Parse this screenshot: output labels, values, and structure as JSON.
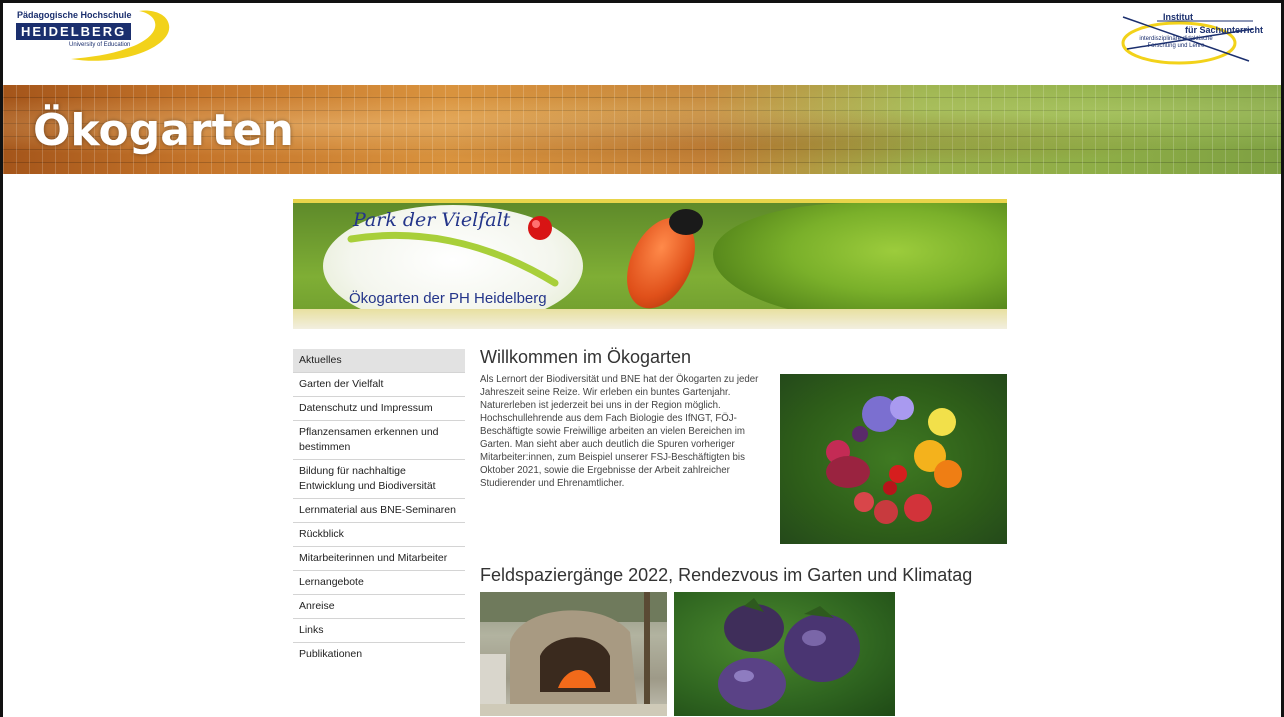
{
  "logos": {
    "ph": {
      "line1": "Pädagogische Hochschule",
      "line2": "HEIDELBERG",
      "line3": "University of Education"
    },
    "institute": {
      "line1": "Institut",
      "line2": "für Sachunterricht",
      "line3": "interdisziplinäre didaktische Forschung und Lehre"
    }
  },
  "banner": {
    "title": "Ökogarten"
  },
  "site_header": {
    "title": "Park der Vielfalt",
    "subtitle": "Ökogarten der PH Heidelberg"
  },
  "nav": {
    "items": [
      {
        "label": "Aktuelles",
        "active": true
      },
      {
        "label": "Garten der Vielfalt"
      },
      {
        "label": "Datenschutz und Impressum"
      },
      {
        "label": "Pflanzensamen erkennen und bestimmen"
      },
      {
        "label": "Bildung für nachhaltige Entwicklung und Biodiversität"
      },
      {
        "label": "Lernmaterial aus BNE-Seminaren"
      },
      {
        "label": "Rückblick"
      },
      {
        "label": "Mitarbeiterinnen und Mitarbeiter"
      },
      {
        "label": "Lernangebote"
      },
      {
        "label": "Anreise"
      },
      {
        "label": "Links"
      },
      {
        "label": "Publikationen"
      }
    ]
  },
  "main": {
    "heading": "Willkommen im Ökogarten",
    "intro": "Als Lernort der Biodiversität und BNE hat der Ökogarten zu jeder Jahreszeit seine Reize. Wir erleben ein buntes Gartenjahr. Naturerleben ist jederzeit bei uns in der Region möglich. Hochschullehrende aus dem Fach Biologie des IfNGT, FÖJ-Beschäftigte sowie Freiwillige arbeiten an vielen Bereichen im Garten. Man sieht aber auch deutlich die Spuren vorheriger Mitarbeiter:innen, zum Beispiel unserer FSJ-Beschäftigten bis Oktober 2021, sowie die Ergebnisse der Arbeit zahlreicher Studierender und Ehrenamtlicher.",
    "heading2": "Feldspaziergänge 2022, Rendezvous im Garten und Klimatag"
  },
  "colors": {
    "brand_blue": "#1b2f6e",
    "brand_yellow": "#f2d21a",
    "nav_active_bg": "#e2e2e2"
  }
}
